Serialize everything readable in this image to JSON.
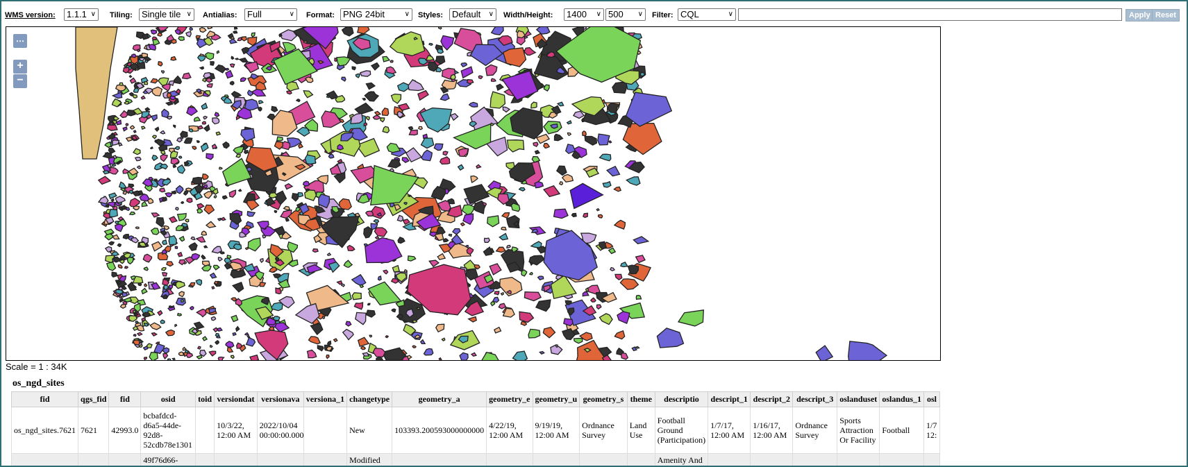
{
  "toolbar": {
    "wms_version_label": "WMS version:",
    "wms_version_value": "1.1.1",
    "tiling_label": "Tiling:",
    "tiling_value": "Single tile",
    "antialias_label": "Antialias:",
    "antialias_value": "Full",
    "format_label": "Format:",
    "format_value": "PNG 24bit",
    "styles_label": "Styles:",
    "styles_value": "Default",
    "wh_label": "Width/Height:",
    "width_value": "1400",
    "height_value": "500",
    "filter_label": "Filter:",
    "filter_type_value": "CQL",
    "filter_text": "",
    "apply_label": "Apply",
    "reset_label": "Reset"
  },
  "map": {
    "pan_icon": "pan-menu-icon",
    "zoom_in": "+",
    "zoom_out": "−",
    "scale_text": "Scale = 1 : 34K",
    "colors": [
      "#d94e9b",
      "#6c63d6",
      "#7ad45a",
      "#e0663a",
      "#9b33d8",
      "#c9a8e0",
      "#f0b98a",
      "#4ea8b8",
      "#b0d65a",
      "#d33a7a"
    ]
  },
  "table": {
    "title": "os_ngd_sites",
    "headers": [
      "fid",
      "qgs_fid",
      "fid",
      "osid",
      "toid",
      "versiondat",
      "versionava",
      "versiona_1",
      "changetype",
      "geometry_a",
      "geometry_e",
      "geometry_u",
      "geometry_s",
      "theme",
      "descriptio",
      "descript_1",
      "descript_2",
      "descript_3",
      "oslanduset",
      "oslandus_1",
      "osl"
    ],
    "rows": [
      [
        "os_ngd_sites.7621",
        "7621",
        "42993.0",
        "bcbafdcd-d6a5-44de-92d8-52cdb78e1301",
        "",
        "10/3/22, 12:00 AM",
        "2022/10/04 00:00:00.000",
        "",
        "New",
        "103393.200593000000000",
        "4/22/19, 12:00 AM",
        "9/19/19, 12:00 AM",
        "Ordnance Survey",
        "Land Use",
        "Football Ground (Participation)",
        "1/7/17, 12:00 AM",
        "1/16/17, 12:00 AM",
        "Ordnance Survey",
        "Sports Attraction Or Facility",
        "Football",
        "1/7 12:"
      ],
      [
        "",
        "",
        "",
        "49f76d66-",
        "",
        "",
        "",
        "",
        "Modified",
        "",
        "",
        "",
        "",
        "",
        "Amenity And",
        "",
        "",
        "",
        "",
        "",
        ""
      ]
    ]
  }
}
